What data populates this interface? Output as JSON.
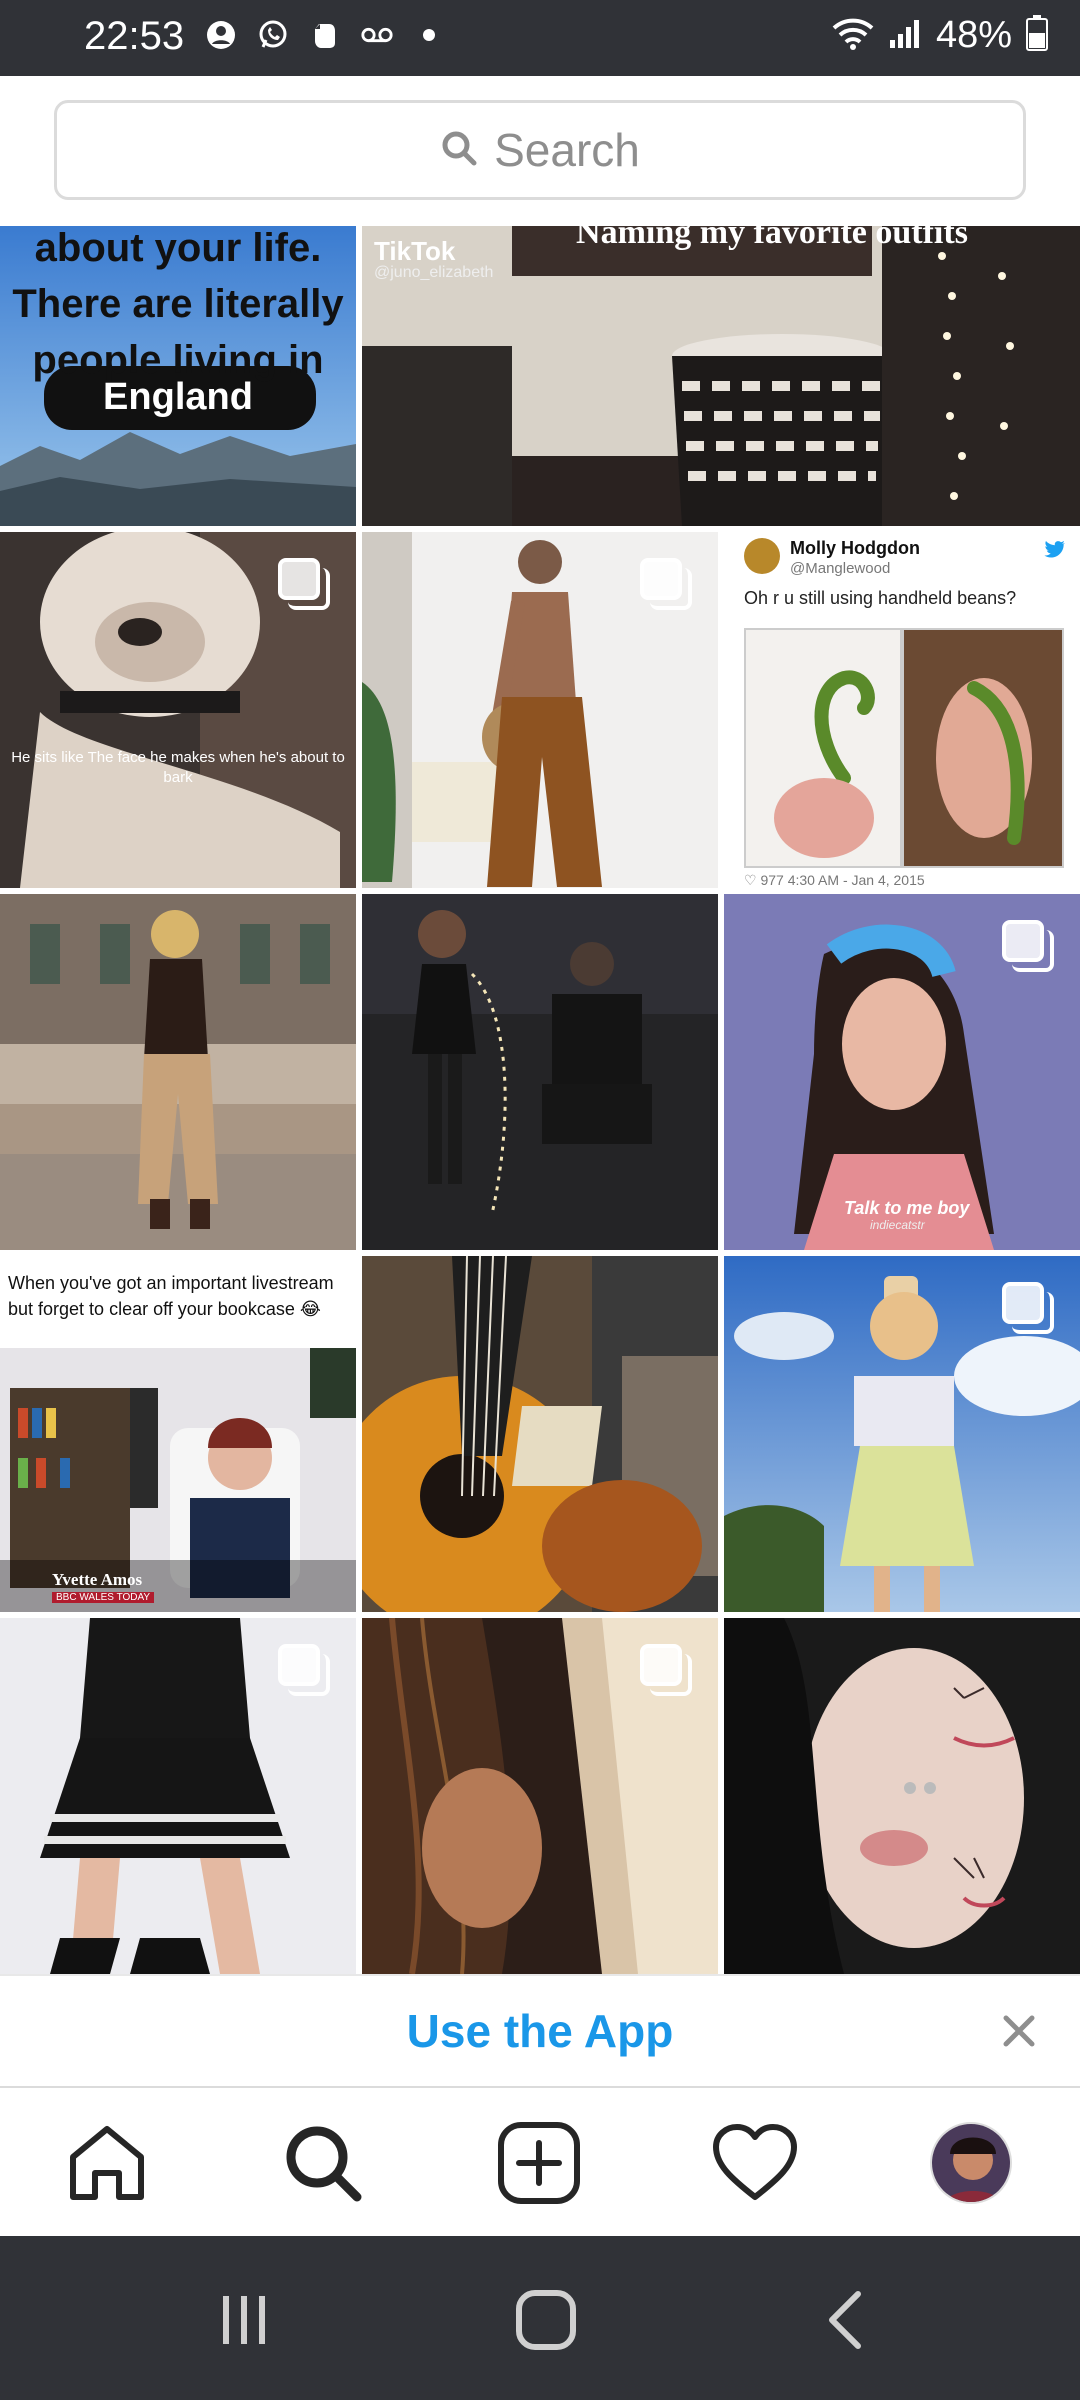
{
  "status_bar": {
    "time": "22:53",
    "battery": "48%",
    "left_icons": [
      "account-icon",
      "whatsapp-icon",
      "evernote-icon",
      "voicemail-icon",
      "dot-icon"
    ],
    "right_icons": [
      "wifi-icon",
      "signal-icon",
      "battery-icon"
    ]
  },
  "search": {
    "placeholder": "Search"
  },
  "grid": {
    "tile_1": {
      "lines": [
        "about your life.",
        "There are literally",
        "people living in"
      ],
      "label": "England"
    },
    "tile_2": {
      "brand": "TikTok",
      "handle": "@juno_elizabeth",
      "caption": "Naming my favorite outfits"
    },
    "tile_3": {
      "caption": "He sits like The face he makes when he's about to bark"
    },
    "tile_5": {
      "name": "Molly Hodgdon",
      "handle": "@Manglewood",
      "text": "Oh r u still using handheld beans?",
      "footer": "♡ 977   4:30 AM - Jan 4, 2015"
    },
    "tile_8": {
      "caption": "Talk to me boy",
      "watermark": "indiecatstr"
    },
    "tile_9": {
      "text": "When you've got an important livestream but forget to clear off your bookcase 😂",
      "name": "Yvette Amos",
      "channel": "BBC WALES TODAY"
    }
  },
  "banner": {
    "label": "Use the App"
  },
  "colors": {
    "accent": "#1a97e8",
    "system_bar": "#303237"
  }
}
